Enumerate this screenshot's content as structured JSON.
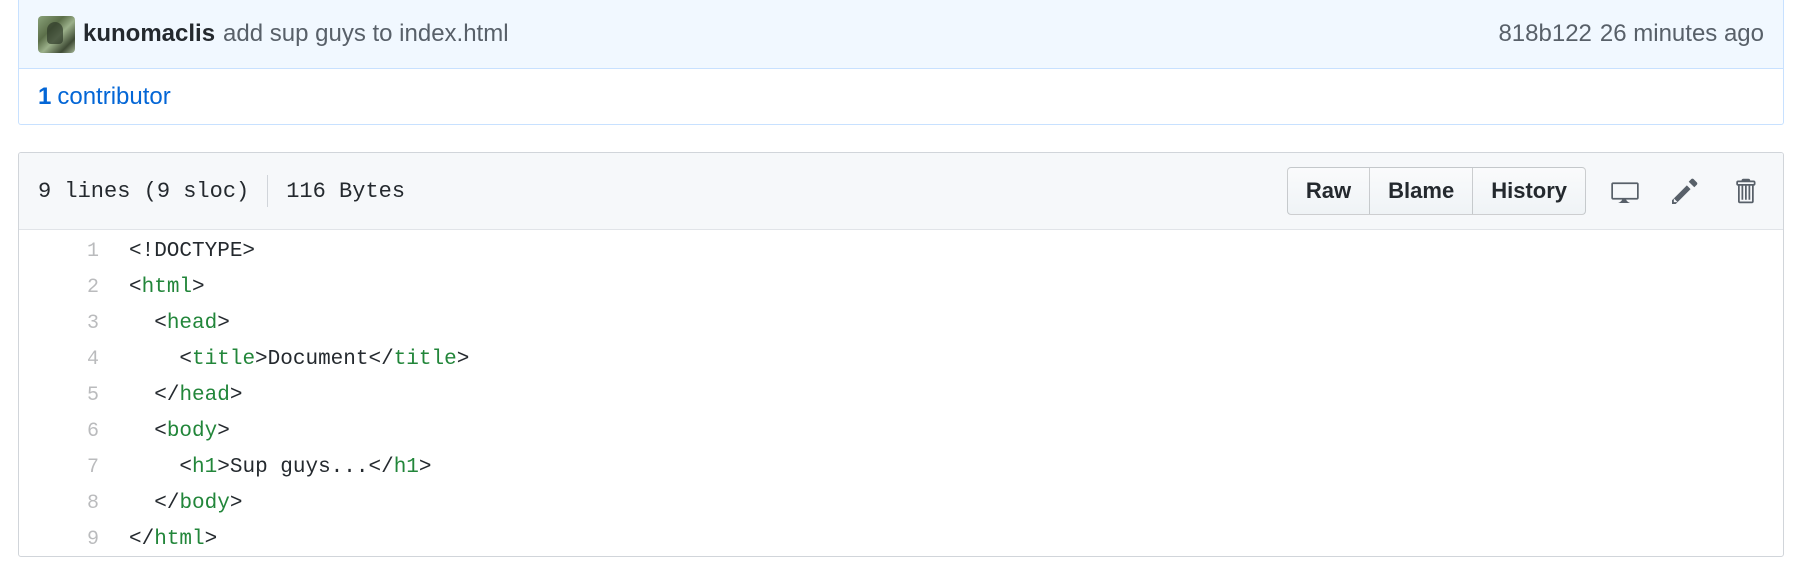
{
  "commit": {
    "author": "kunomaclis",
    "message": "add sup guys to index.html",
    "sha": "818b122",
    "time": "26 minutes ago"
  },
  "contributors": {
    "count": "1",
    "label": "contributor"
  },
  "file": {
    "lines": "9 lines (9 sloc)",
    "size": "116 Bytes",
    "buttons": {
      "raw": "Raw",
      "blame": "Blame",
      "history": "History"
    },
    "icons": [
      "desktop-icon",
      "pencil-icon",
      "trashcan-icon"
    ]
  },
  "code_lines": [
    {
      "num": "1",
      "indent": "",
      "open": "<!DOCTYPE>",
      "tag": "",
      "close": "",
      "text": "",
      "endtag": "",
      "end": ""
    },
    {
      "num": "2",
      "indent": "",
      "open": "<",
      "tag": "html",
      "close": ">",
      "text": "",
      "endtag": "",
      "end": ""
    },
    {
      "num": "3",
      "indent": "  ",
      "open": "<",
      "tag": "head",
      "close": ">",
      "text": "",
      "endtag": "",
      "end": ""
    },
    {
      "num": "4",
      "indent": "    ",
      "open": "<",
      "tag": "title",
      "close": ">",
      "text": "Document</",
      "endtag": "title",
      "end": ">"
    },
    {
      "num": "5",
      "indent": "  ",
      "open": "</",
      "tag": "head",
      "close": ">",
      "text": "",
      "endtag": "",
      "end": ""
    },
    {
      "num": "6",
      "indent": "  ",
      "open": "<",
      "tag": "body",
      "close": ">",
      "text": "",
      "endtag": "",
      "end": ""
    },
    {
      "num": "7",
      "indent": "    ",
      "open": "<",
      "tag": "h1",
      "close": ">",
      "text": "Sup guys...</",
      "endtag": "h1",
      "end": ">"
    },
    {
      "num": "8",
      "indent": "  ",
      "open": "</",
      "tag": "body",
      "close": ">",
      "text": "",
      "endtag": "",
      "end": ""
    },
    {
      "num": "9",
      "indent": "",
      "open": "</",
      "tag": "html",
      "close": ">",
      "text": "",
      "endtag": "",
      "end": ""
    }
  ],
  "colors": {
    "link": "#0366d6",
    "tag": "#22863a",
    "commit_bg": "#f1f8ff"
  }
}
